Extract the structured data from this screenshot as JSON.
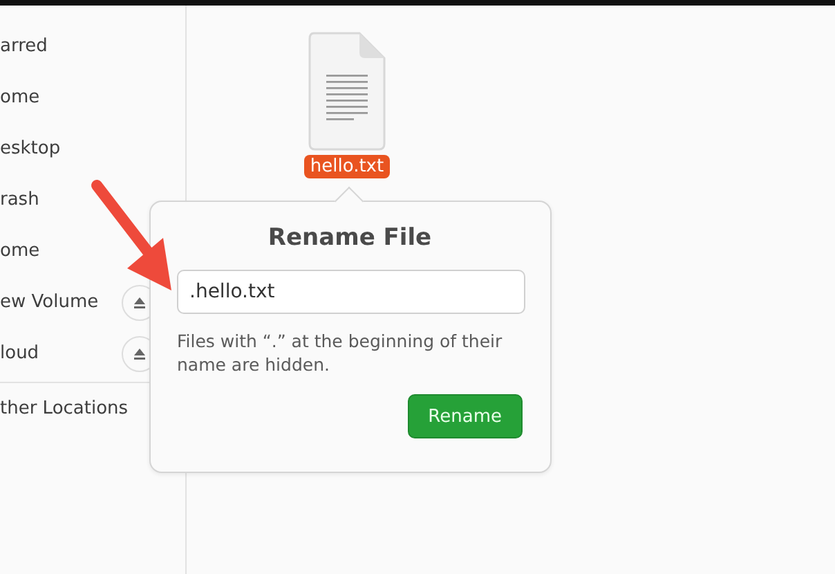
{
  "sidebar": {
    "items": [
      {
        "label": "arred",
        "eject": false
      },
      {
        "label": "ome",
        "eject": false
      },
      {
        "label": "esktop",
        "eject": false
      },
      {
        "label": "rash",
        "eject": false
      },
      {
        "label": "ome",
        "eject": false
      },
      {
        "label": "ew Volume",
        "eject": true
      },
      {
        "label": "loud",
        "eject": true
      }
    ],
    "other": {
      "label": "ther Locations"
    }
  },
  "file": {
    "name": "hello.txt",
    "selected": true
  },
  "rename_popover": {
    "title": "Rename File",
    "value": ".hello.txt",
    "hint": "Files with “.” at the beginning of their name are hidden.",
    "button": "Rename"
  }
}
